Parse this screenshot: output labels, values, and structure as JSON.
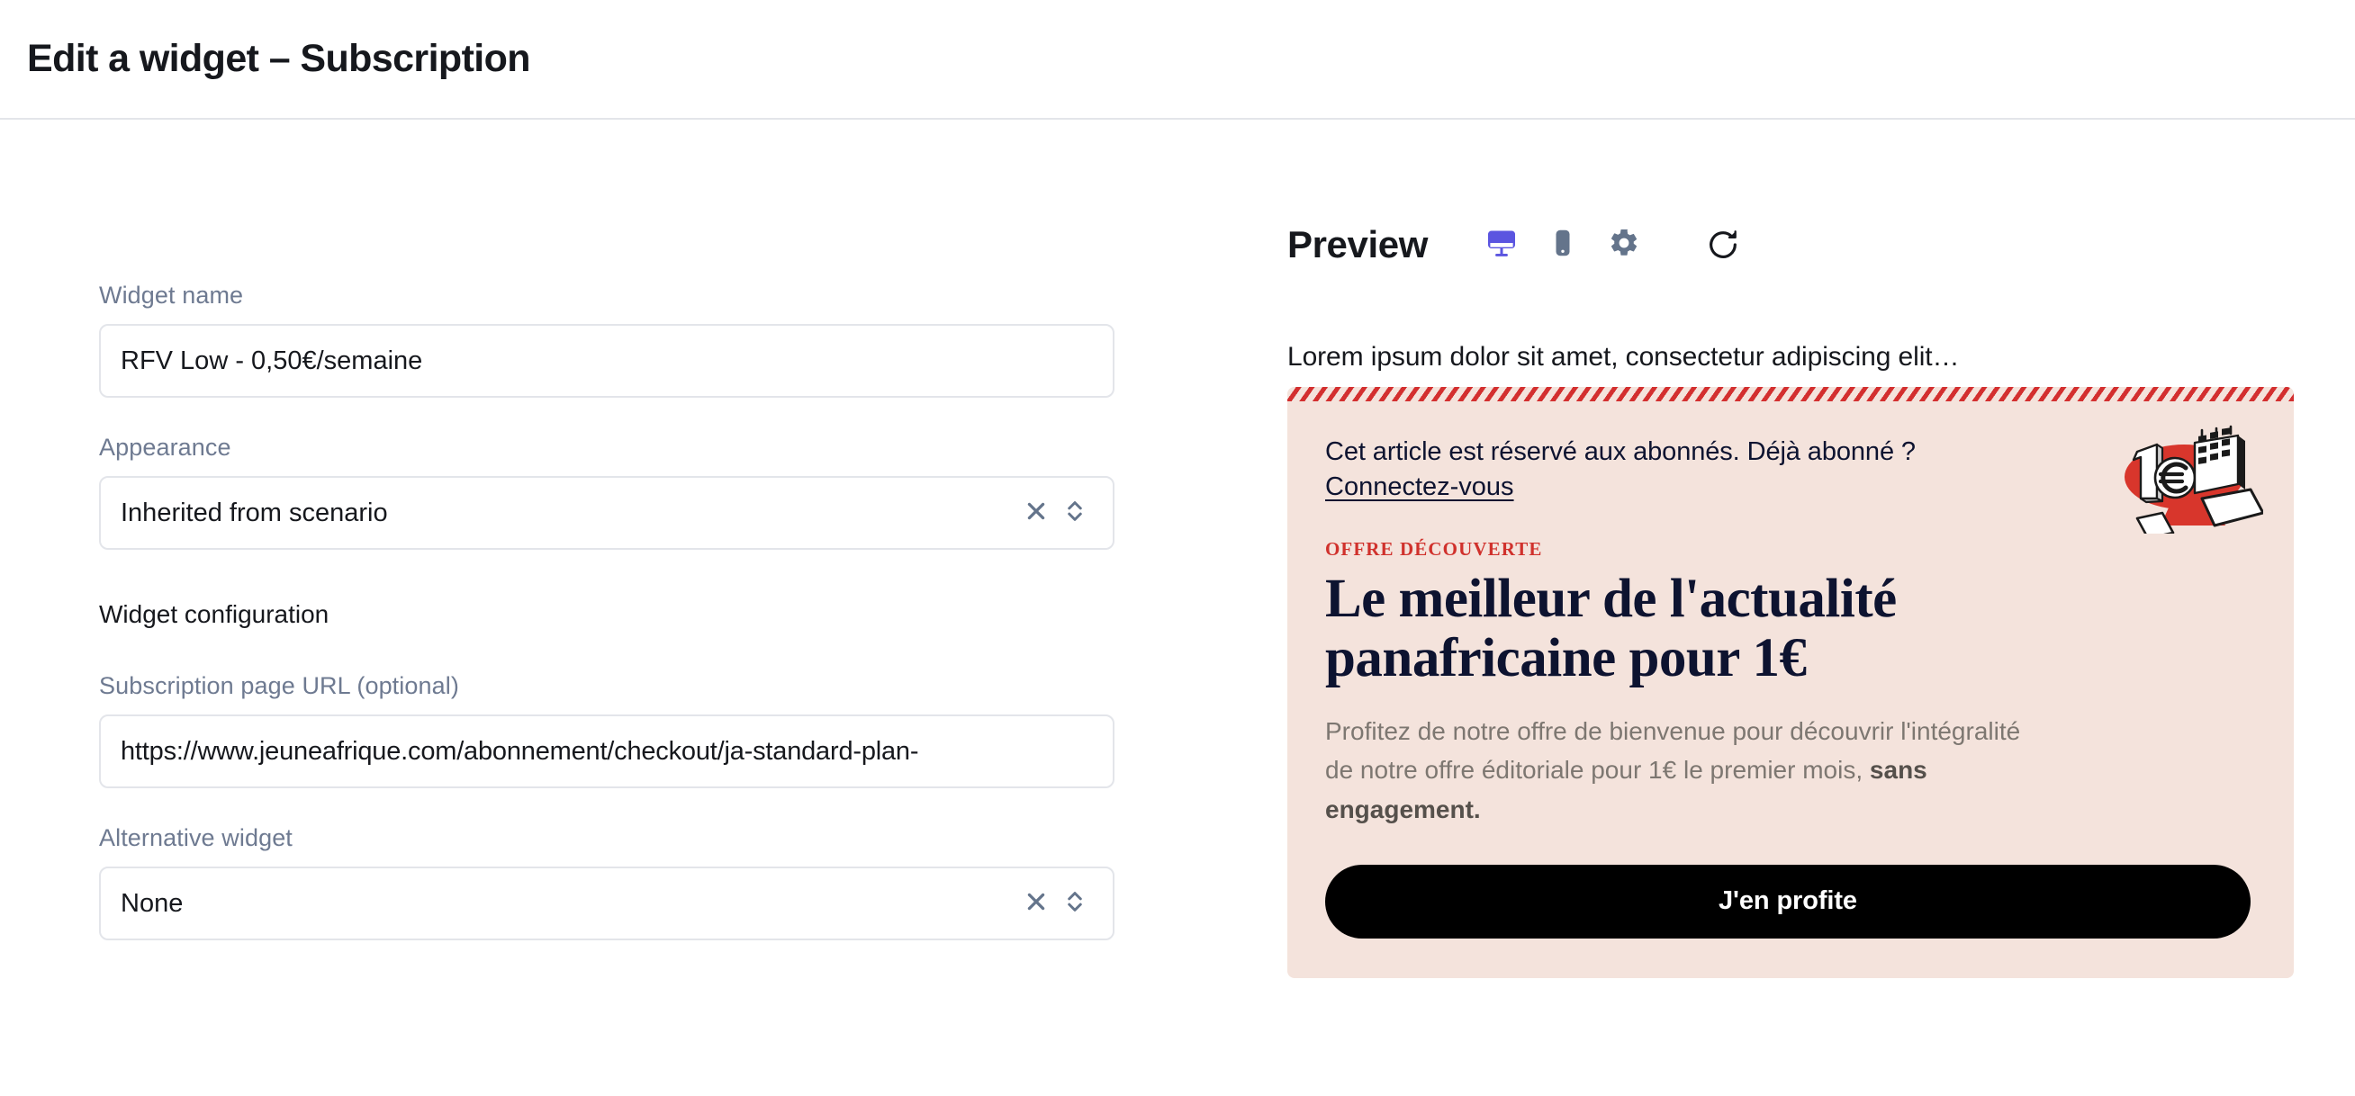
{
  "header": {
    "title": "Edit a widget – Subscription"
  },
  "form": {
    "widget_name": {
      "label": "Widget name",
      "value": "RFV Low - 0,50€/semaine"
    },
    "appearance": {
      "label": "Appearance",
      "value": "Inherited from scenario",
      "clear_icon": "close-icon",
      "toggle_icon": "chevron-up-down-icon"
    },
    "configuration_heading": "Widget configuration",
    "subscription_url": {
      "label": "Subscription page URL (optional)",
      "value": "https://www.jeuneafrique.com/abonnement/checkout/ja-standard-plan-"
    },
    "alternative_widget": {
      "label": "Alternative widget",
      "value": "None",
      "clear_icon": "close-icon",
      "toggle_icon": "chevron-up-down-icon"
    }
  },
  "preview": {
    "title": "Preview",
    "devices": [
      {
        "name": "desktop-icon",
        "active": true
      },
      {
        "name": "mobile-icon",
        "active": false
      },
      {
        "name": "gear-icon",
        "active": false
      }
    ],
    "refresh_icon": "refresh-icon",
    "lorem": "Lorem ipsum dolor sit amet, consectetur adipiscing elit…"
  },
  "paywall": {
    "notice": "Cet article est réservé aux abonnés. Déjà abonné ?",
    "login_link": "Connectez-vous",
    "eyebrow": "OFFRE DÉCOUVERTE",
    "headline": "Le meilleur de l'actualité panafricaine pour 1€",
    "body_lead": "Profitez de notre offre de bienvenue pour découvrir l'intégralité de notre offre éditoriale pour 1€ le premier mois, ",
    "body_strong": "sans engagement.",
    "cta": "J'en profite",
    "illustration": "one-euro-calendar-devices-illustration"
  },
  "colors": {
    "accent": "#5b55e0",
    "label": "#6e7a91",
    "border": "#e3e5ea",
    "paywall_bg": "#f4e3dc",
    "paywall_red": "#d0312c",
    "paywall_navy": "#0d1330"
  }
}
